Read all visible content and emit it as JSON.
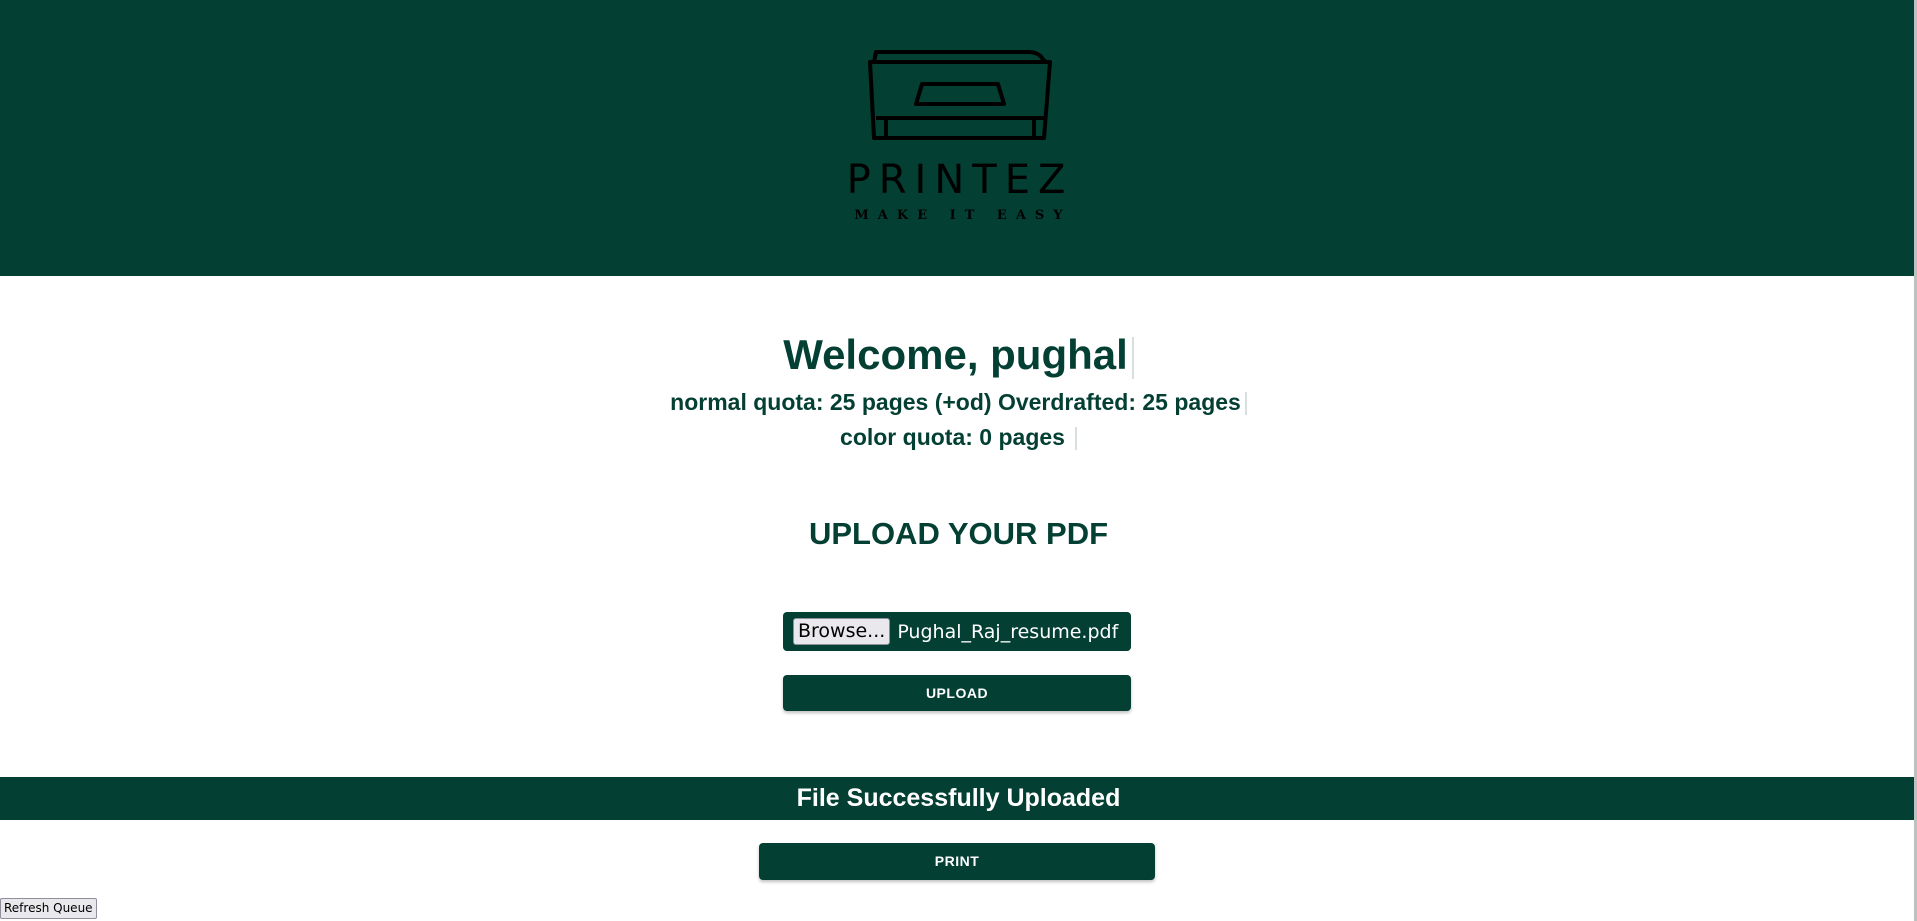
{
  "brand": {
    "name": "PRINTEZ",
    "tagline": "MAKE IT EASY"
  },
  "user": {
    "welcome": "Welcome, pughal",
    "normal_quota": "normal quota: 25 pages (+od) Overdrafted: 25 pages",
    "color_quota": "color quota: 0 pages"
  },
  "upload": {
    "title": "UPLOAD YOUR PDF",
    "browse_label": "Browse...",
    "selected_file": "Pughal_Raj_resume.pdf",
    "upload_label": "UPLOAD"
  },
  "status": {
    "message": "File Successfully Uploaded"
  },
  "actions": {
    "print_label": "PRINT",
    "refresh_label": "Refresh Queue"
  },
  "colors": {
    "primary": "#033f33",
    "text_on_primary": "#ffffff",
    "background": "#ffffff"
  }
}
